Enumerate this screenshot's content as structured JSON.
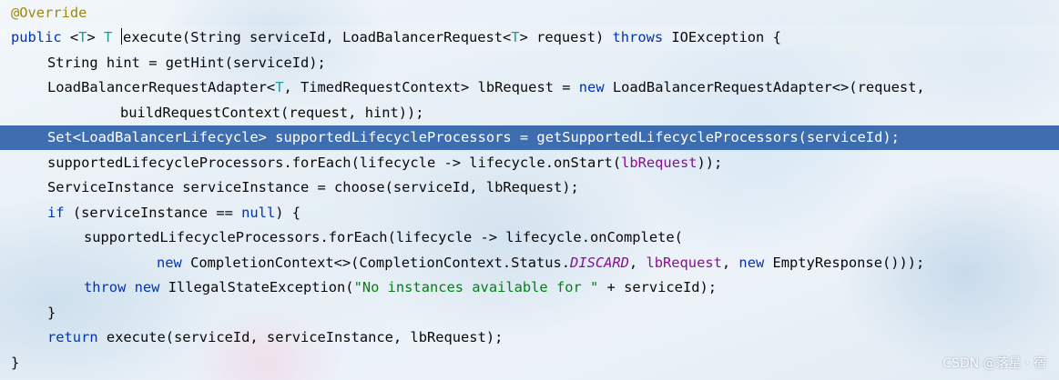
{
  "editor": {
    "lines": [
      [
        "@Override"
      ],
      [
        "public",
        " <",
        "T",
        "> ",
        "T",
        " ",
        "execute",
        "(String serviceId, LoadBalancerRequest<",
        "T",
        "> request) ",
        "throws",
        " IOException {"
      ],
      [
        "String hint = getHint(serviceId);"
      ],
      [
        "LoadBalancerRequestAdapter<",
        "T",
        ", TimedRequestContext> lbRequest = ",
        "new",
        " LoadBalancerRequestAdapter<>(request,"
      ],
      [
        "buildRequestContext(request, hint));"
      ],
      [
        "Set<LoadBalancerLifecycle> supportedLifecycleProcessors = getSupportedLifecycleProcessors(serviceId);"
      ],
      [
        "supportedLifecycleProcessors.forEach(lifecycle -> lifecycle.onStart(",
        "lbRequest",
        "));"
      ],
      [
        "ServiceInstance serviceInstance = choose(serviceId, lbRequest);"
      ],
      [
        "if",
        " (serviceInstance == ",
        "null",
        ") {"
      ],
      [
        "supportedLifecycleProcessors.forEach(lifecycle -> lifecycle.onComplete("
      ],
      [
        "new",
        " CompletionContext<>(CompletionContext.Status.",
        "DISCARD",
        ", ",
        "lbRequest",
        ", ",
        "new",
        " EmptyResponse()));"
      ],
      [
        "throw",
        " ",
        "new",
        " IllegalStateException(",
        "\"No instances available for \"",
        " + serviceId);"
      ],
      [
        "}"
      ],
      [
        "return",
        " execute(serviceId, serviceInstance, lbRequest);"
      ],
      [
        "}"
      ]
    ]
  },
  "watermark": "CSDN @落星 · 宿",
  "colors": {
    "keyword": "#0033b3",
    "annotation": "#9e880d",
    "type_param": "#20999d",
    "string": "#067d17",
    "field": "#871094",
    "selection": "#265ba5"
  }
}
